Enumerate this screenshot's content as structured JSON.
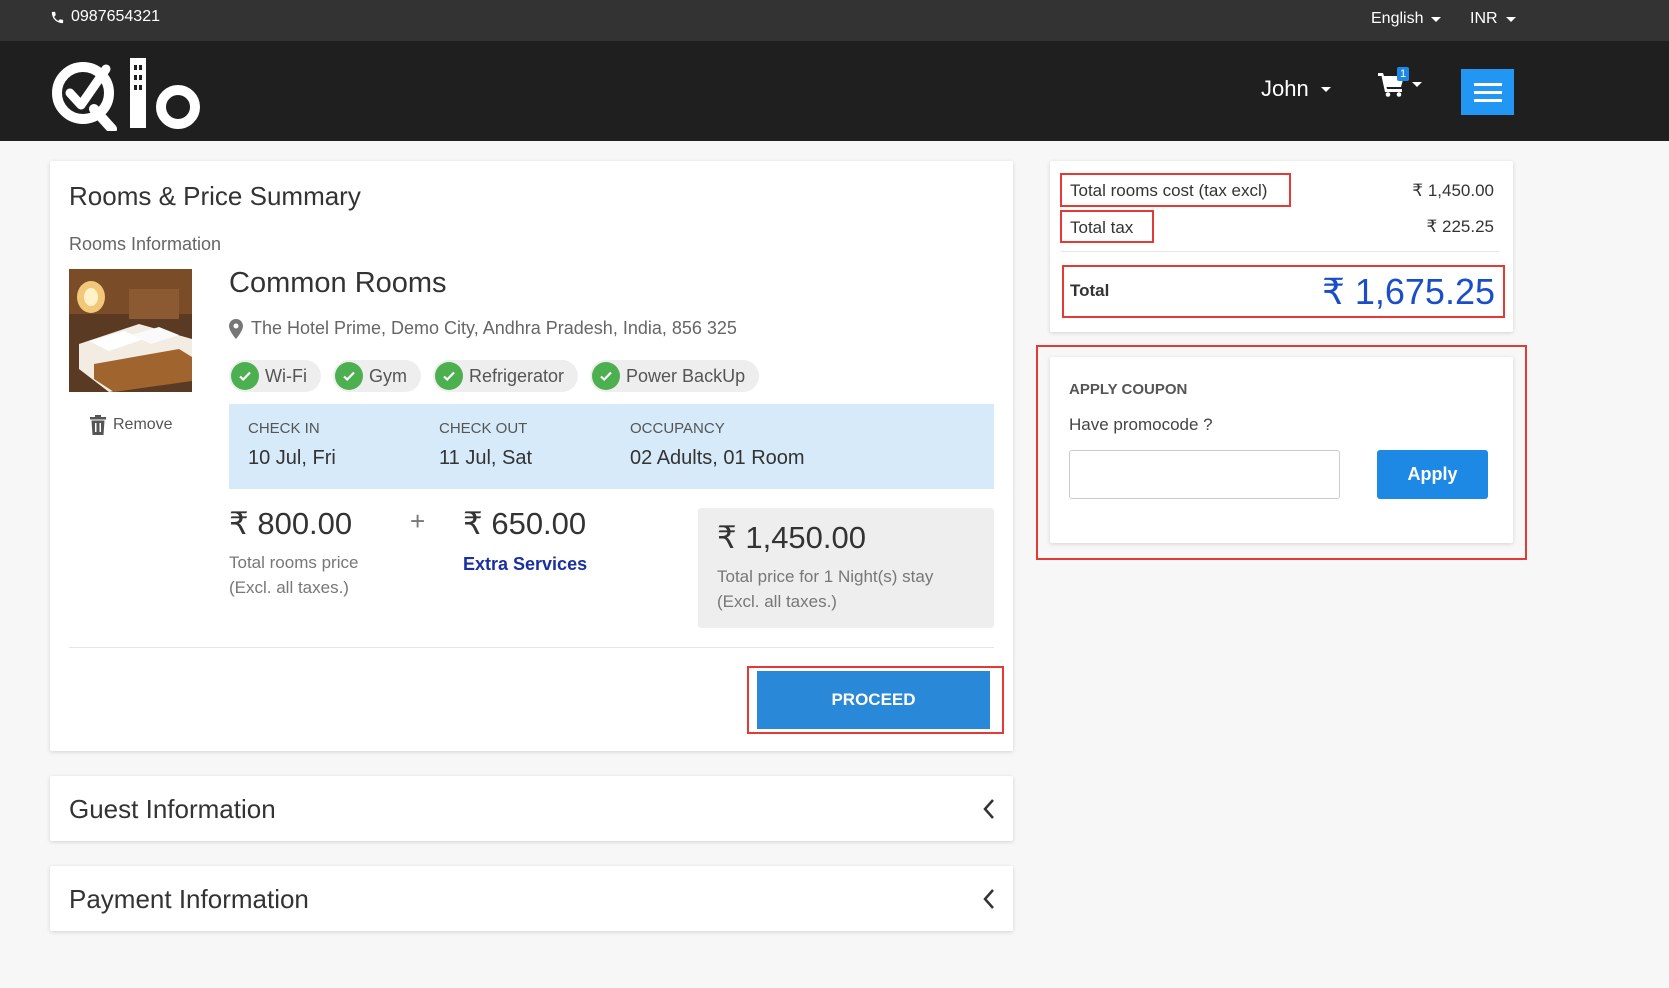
{
  "topbar": {
    "phone": "0987654321",
    "language": "English",
    "currency": "INR"
  },
  "navbar": {
    "user_name": "John",
    "cart_count": "1",
    "icons": {
      "logo": "qlo-logo",
      "cart": "cart-icon",
      "menu": "hamburger-icon"
    }
  },
  "summary": {
    "title": "Rooms & Price Summary",
    "subtitle": "Rooms Information",
    "remove_label": "Remove",
    "room": {
      "name": "Common Rooms",
      "address": "The Hotel Prime, Demo City, Andhra Pradesh, India, 856 325",
      "amenities": [
        "Wi-Fi",
        "Gym",
        "Refrigerator",
        "Power BackUp"
      ]
    },
    "stay": {
      "checkin_label": "CHECK IN",
      "checkin_value": "10 Jul, Fri",
      "checkout_label": "CHECK OUT",
      "checkout_value": "11 Jul, Sat",
      "occupancy_label": "OCCUPANCY",
      "occupancy_value": "02 Adults, 01 Room"
    },
    "rooms_price": "₹ 800.00",
    "rooms_price_desc1": "Total rooms price",
    "rooms_price_desc2": "(Excl. all taxes.)",
    "plus": "+",
    "extra_price": "₹ 650.00",
    "extra_label": "Extra Services",
    "total_price": "₹ 1,450.00",
    "total_desc1": "Total price for 1 Night(s) stay",
    "total_desc2": "(Excl. all taxes.)",
    "proceed_label": "PROCEED"
  },
  "sections": {
    "guest": "Guest Information",
    "payment": "Payment Information"
  },
  "totals": {
    "rooms_cost_label": "Total rooms cost (tax excl)",
    "rooms_cost_value": "₹ 1,450.00",
    "tax_label": "Total tax",
    "tax_value": "₹ 225.25",
    "total_label": "Total",
    "total_value": "₹ 1,675.25"
  },
  "coupon": {
    "heading": "APPLY COUPON",
    "question": "Have promocode ?",
    "input_value": "",
    "apply_label": "Apply"
  },
  "colors": {
    "accent": "#1e88e5",
    "highlight_border": "#e53935",
    "amenity_check": "#4caf50",
    "stay_bg": "#d6eafa",
    "grand_total": "#1a4ec9"
  }
}
